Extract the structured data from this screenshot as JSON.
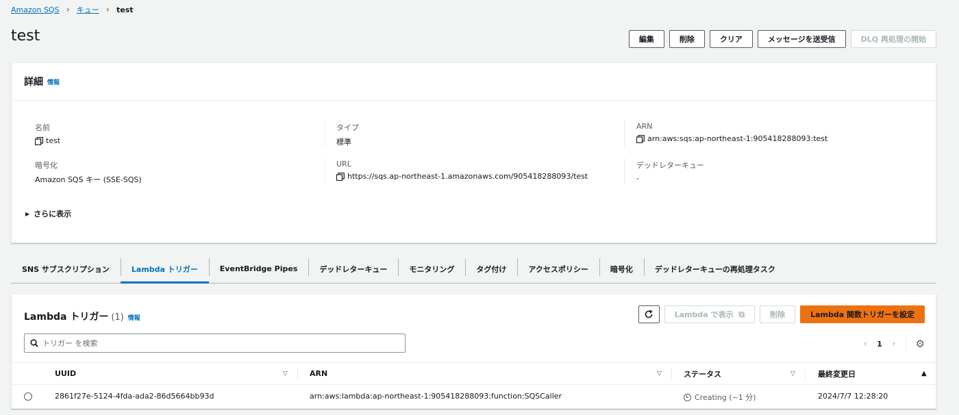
{
  "breadcrumb": {
    "root": "Amazon SQS",
    "queues": "キュー",
    "current": "test"
  },
  "page": {
    "title": "test"
  },
  "header_actions": {
    "edit": "編集",
    "delete": "削除",
    "purge": "クリア",
    "send_receive": "メッセージを送受信",
    "dlq_redrive": "DLQ 再処理の開始"
  },
  "details": {
    "title": "詳細",
    "info": "情報",
    "name_label": "名前",
    "name_value": "test",
    "type_label": "タイプ",
    "type_value": "標準",
    "arn_label": "ARN",
    "arn_value": "arn:aws:sqs:ap-northeast-1:905418288093:test",
    "encryption_label": "暗号化",
    "encryption_value": "Amazon SQS キー (SSE-SQS)",
    "url_label": "URL",
    "url_value": "https://sqs.ap-northeast-1.amazonaws.com/905418288093/test",
    "dlq_label": "デッドレターキュー",
    "dlq_value": "-",
    "more": "さらに表示"
  },
  "tabs": [
    {
      "label": "SNS サブスクリプション",
      "active": false
    },
    {
      "label": "Lambda トリガー",
      "active": true
    },
    {
      "label": "EventBridge Pipes",
      "active": false
    },
    {
      "label": "デッドレターキュー",
      "active": false
    },
    {
      "label": "モニタリング",
      "active": false
    },
    {
      "label": "タグ付け",
      "active": false
    },
    {
      "label": "アクセスポリシー",
      "active": false
    },
    {
      "label": "暗号化",
      "active": false
    },
    {
      "label": "デッドレターキューの再処理タスク",
      "active": false
    }
  ],
  "lambda": {
    "title": "Lambda トリガー",
    "count": "(1)",
    "info": "情報",
    "view_in_lambda": "Lambda で表示",
    "delete": "削除",
    "configure": "Lambda 関数トリガーを設定",
    "search_placeholder": "トリガー を検索",
    "page": "1",
    "columns": {
      "uuid": "UUID",
      "arn": "ARN",
      "status": "ステータス",
      "last_modified": "最終変更日"
    },
    "rows": [
      {
        "uuid": "2861f27e-5124-4fda-ada2-86d5664bb93d",
        "arn": "arn:aws:lambda:ap-northeast-1:905418288093:function:SQSCaller",
        "status": "Creating (~1 分)",
        "last_modified": "2024/7/7 12:28:20"
      }
    ]
  },
  "colors": {
    "link": "#0073bb",
    "primary": "#ec7211",
    "background": "#f2f3f3"
  }
}
